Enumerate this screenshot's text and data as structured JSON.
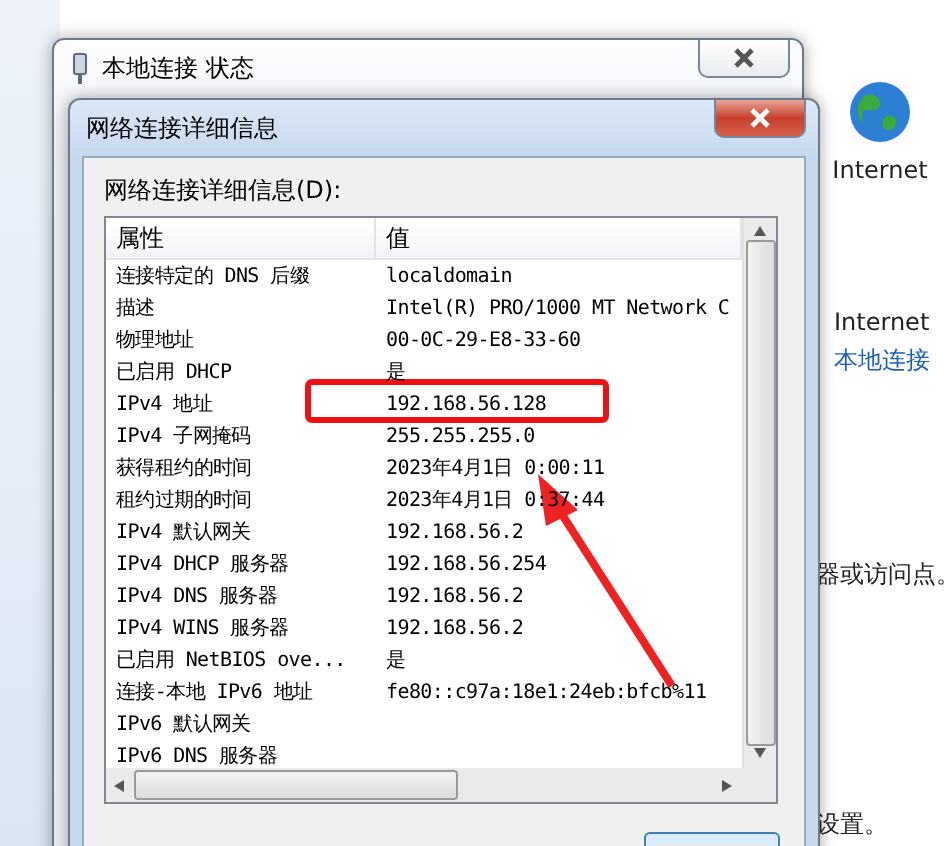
{
  "background_window": {
    "items": [
      {
        "kind": "globe",
        "label": "Internet"
      },
      {
        "kind": "text",
        "label": "Internet"
      },
      {
        "kind": "link",
        "label": "本地连接"
      },
      {
        "kind": "text",
        "label": "器或访问点。"
      },
      {
        "kind": "text",
        "label": "设置。"
      }
    ]
  },
  "status_dialog": {
    "title": "本地连接 状态"
  },
  "details_dialog": {
    "title": "网络连接详细信息",
    "list_label": "网络连接详细信息(D):",
    "columns": [
      "属性",
      "值"
    ],
    "rows": [
      {
        "property": "连接特定的 DNS 后缀",
        "value": "localdomain"
      },
      {
        "property": "描述",
        "value": "Intel(R) PRO/1000 MT Network C"
      },
      {
        "property": "物理地址",
        "value": "00-0C-29-E8-33-60"
      },
      {
        "property": "已启用 DHCP",
        "value": "是"
      },
      {
        "property": "IPv4 地址",
        "value": "192.168.56.128",
        "highlighted": true
      },
      {
        "property": "IPv4 子网掩码",
        "value": "255.255.255.0"
      },
      {
        "property": "获得租约的时间",
        "value": "2023年4月1日 0:00:11"
      },
      {
        "property": "租约过期的时间",
        "value": "2023年4月1日 0:37:44"
      },
      {
        "property": "IPv4 默认网关",
        "value": "192.168.56.2"
      },
      {
        "property": "IPv4 DHCP 服务器",
        "value": "192.168.56.254"
      },
      {
        "property": "IPv4 DNS 服务器",
        "value": "192.168.56.2"
      },
      {
        "property": "IPv4 WINS 服务器",
        "value": "192.168.56.2"
      },
      {
        "property": "已启用 NetBIOS ove...",
        "value": "是"
      },
      {
        "property": "连接-本地 IPv6 地址",
        "value": "fe80::c97a:18e1:24eb:bfcb%11"
      },
      {
        "property": "IPv6 默认网关",
        "value": ""
      },
      {
        "property": "IPv6 DNS 服务器",
        "value": ""
      }
    ]
  }
}
